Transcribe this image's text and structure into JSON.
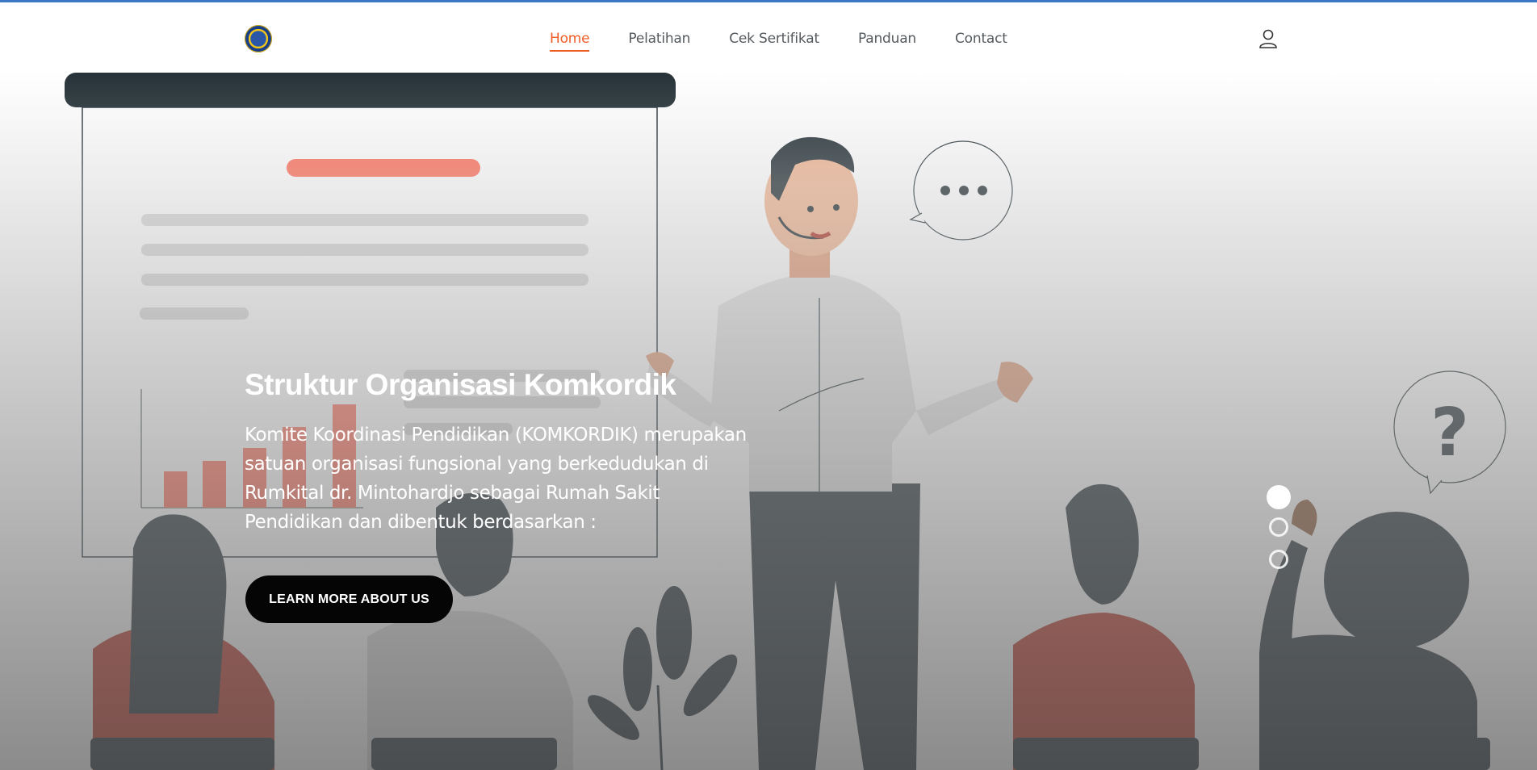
{
  "nav": {
    "logo_alt": "Rumkital dr. Mintohardjo logo",
    "items": [
      {
        "label": "Home",
        "active": true
      },
      {
        "label": "Pelatihan",
        "active": false
      },
      {
        "label": "Cek Sertifikat",
        "active": false
      },
      {
        "label": "Panduan",
        "active": false
      },
      {
        "label": "Contact",
        "active": false
      }
    ],
    "user_icon": "user-icon"
  },
  "hero": {
    "title": "Struktur Organisasi Komkordik",
    "description": "Komite Koordinasi Pendidikan (KOMKORDIK) merupakan satuan organisasi fungsional yang berkedudukan di Rumkital dr. Mintohardjo sebagai Rumah Sakit Pendidikan dan dibentuk berdasarkan :",
    "cta_label": "LEARN MORE ABOUT US",
    "slides": [
      {
        "active": true
      },
      {
        "active": false
      },
      {
        "active": false
      }
    ]
  },
  "colors": {
    "accent": "#ef5b25",
    "topline": "#3b78c3",
    "cta_bg": "#050505"
  }
}
